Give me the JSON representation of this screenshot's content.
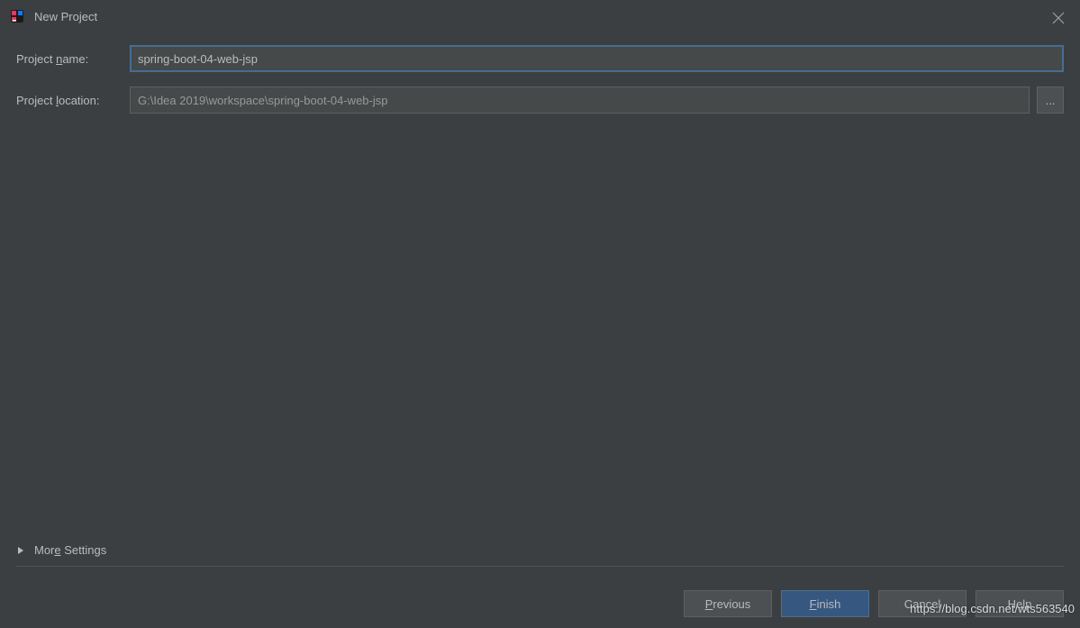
{
  "window": {
    "title": "New Project"
  },
  "form": {
    "projectNameLabel": "Project name:",
    "projectNameValue": "spring-boot-04-web-jsp",
    "projectLocationLabel": "Project location:",
    "projectLocationValue": "G:\\Idea 2019\\workspace\\spring-boot-04-web-jsp",
    "browseLabel": "..."
  },
  "moreSettings": {
    "label": "More Settings"
  },
  "buttons": {
    "previous": "Previous",
    "finish": "Finish",
    "cancel": "Cancel",
    "help": "Help"
  },
  "watermark": "https://blog.csdn.net/wts563540"
}
